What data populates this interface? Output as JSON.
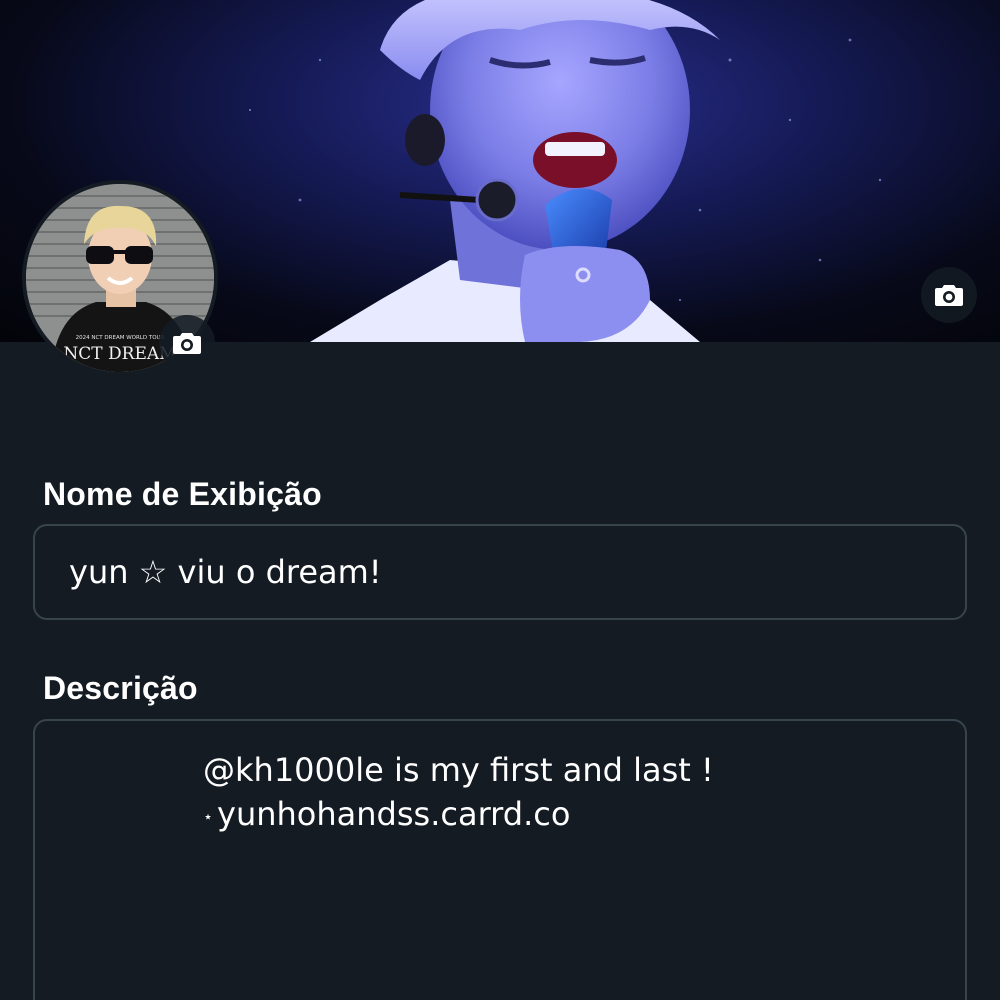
{
  "header": {
    "banner_image": "concert-singer-photo",
    "banner_camera_icon": "camera-icon"
  },
  "avatar": {
    "image": "profile-photo",
    "shirt_text": "NCT DREAM",
    "shirt_subtext": "2024 NCT DREAM WORLD TOUR",
    "camera_icon": "camera-icon"
  },
  "form": {
    "name_label": "Nome de Exibição",
    "name_value": "yun ☆ viu o dream!",
    "description_label": "Descrição",
    "description_lines": [
      "@kh1000le is my first and last !",
      "yunhohandss.carrd.co"
    ],
    "description_star": "⋆"
  },
  "colors": {
    "background": "#141b23",
    "field_border": "#38444d",
    "text": "#ffffff"
  }
}
